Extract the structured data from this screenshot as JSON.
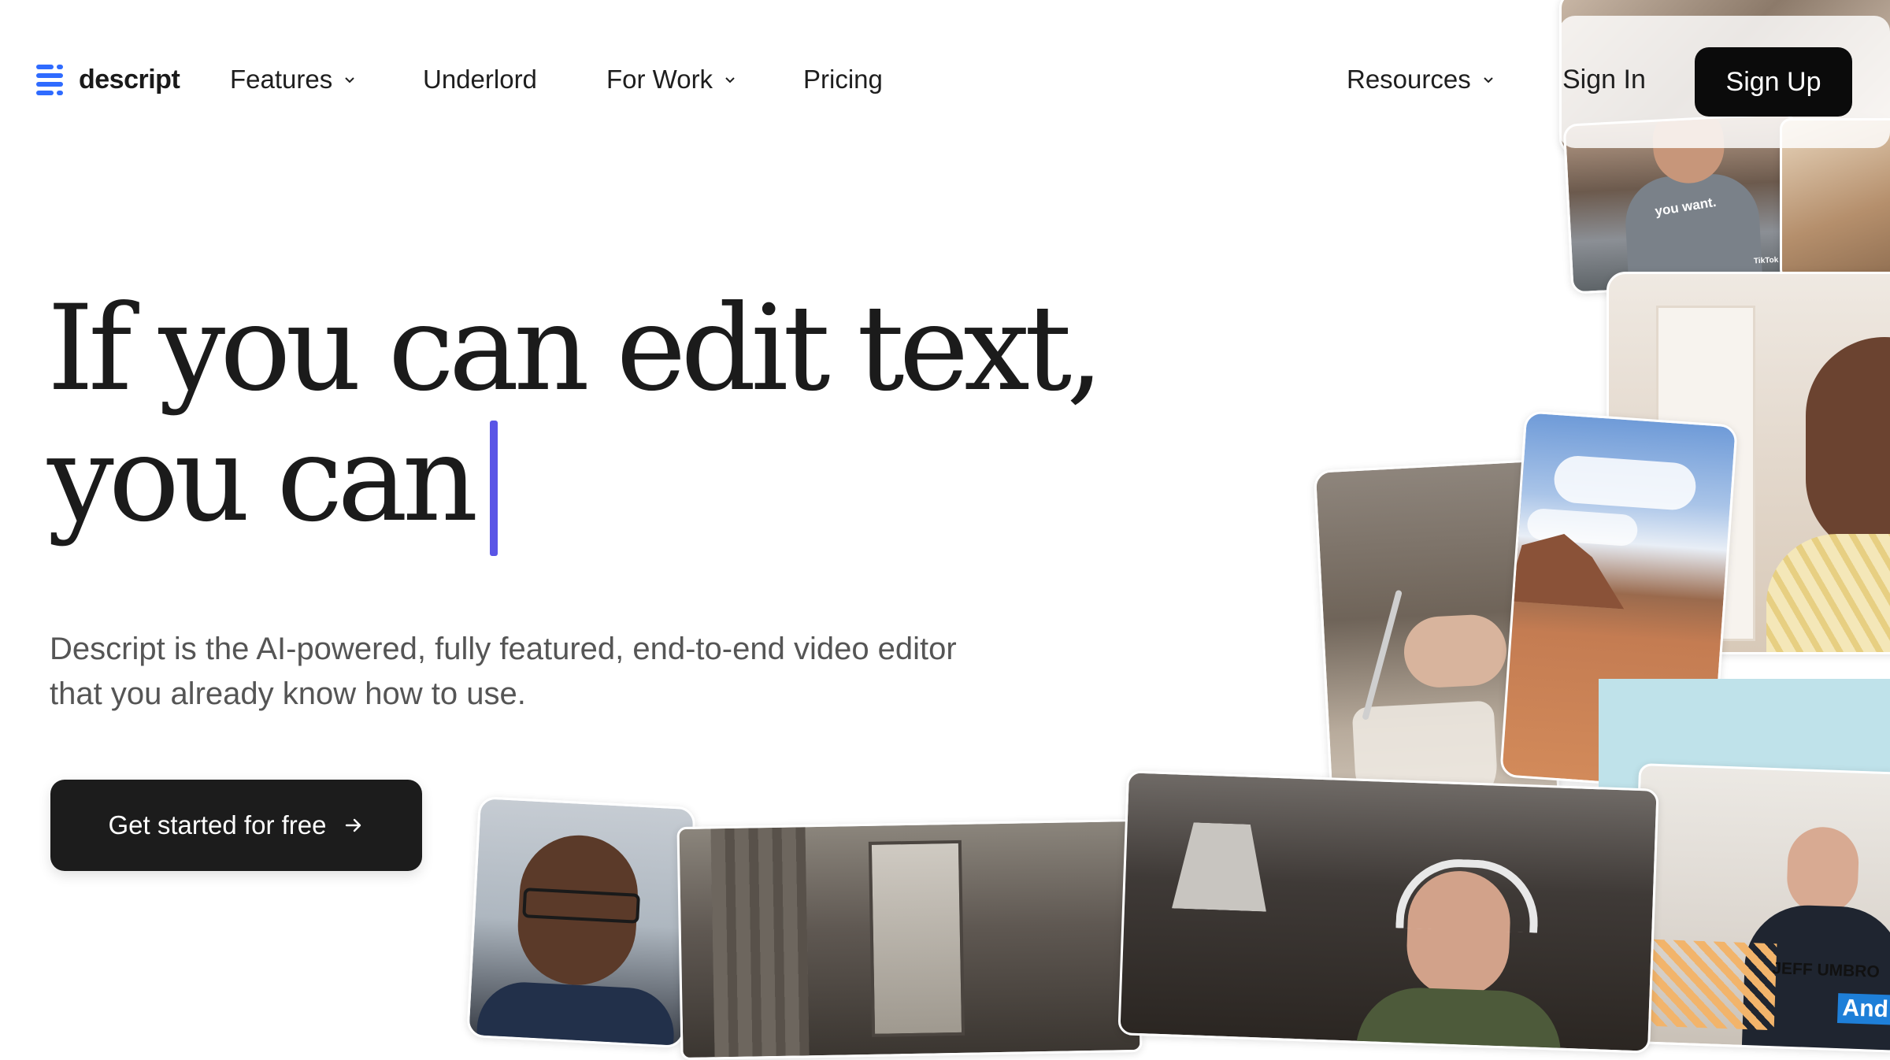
{
  "header": {
    "logo_text": "descript",
    "nav": [
      {
        "label": "Features",
        "has_dropdown": true
      },
      {
        "label": "Underlord",
        "has_dropdown": false
      },
      {
        "label": "For Work",
        "has_dropdown": true
      },
      {
        "label": "Pricing",
        "has_dropdown": false
      }
    ],
    "resources": {
      "label": "Resources",
      "has_dropdown": true
    },
    "sign_in": "Sign In",
    "sign_up": "Sign Up"
  },
  "hero": {
    "headline_line1": "If you can edit text,",
    "headline_line2": "you can",
    "subtitle_line1": "Descript is the AI-powered, fully featured, end-to-end video editor",
    "subtitle_line2": "that you already know how to use.",
    "cta_label": "Get started for free",
    "cta_icon": "arrow-right-icon"
  },
  "collage": {
    "tiktok_caption": "you want.",
    "tiktok_watermark": "TikTok",
    "name_tag": "JEFF UMBRO",
    "caption_word": "And"
  },
  "colors": {
    "accent_caret": "#5a55e6",
    "logo_blue": "#2f6bff",
    "button_dark": "#0b0b0b",
    "text_primary": "#1b1b1b",
    "text_secondary": "#555555"
  }
}
